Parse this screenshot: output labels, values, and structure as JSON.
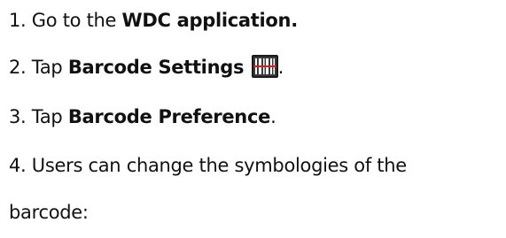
{
  "steps": {
    "s1": {
      "prefix": "1. Go to the ",
      "bold": "WDC application."
    },
    "s2": {
      "prefix": "2. Tap ",
      "bold": "Barcode Settings",
      "suffix": ".",
      "icon": "barcode-settings-icon"
    },
    "s3": {
      "prefix": "3. Tap ",
      "bold": "Barcode Preference",
      "suffix": "."
    },
    "s4": {
      "text": "4. Users can change the symbologies of the"
    },
    "s5": {
      "text": "barcode:"
    }
  },
  "colors": {
    "icon_bg": "#1a1a1a",
    "icon_bars": "#ffffff",
    "icon_scanline": "#d21e1e"
  }
}
